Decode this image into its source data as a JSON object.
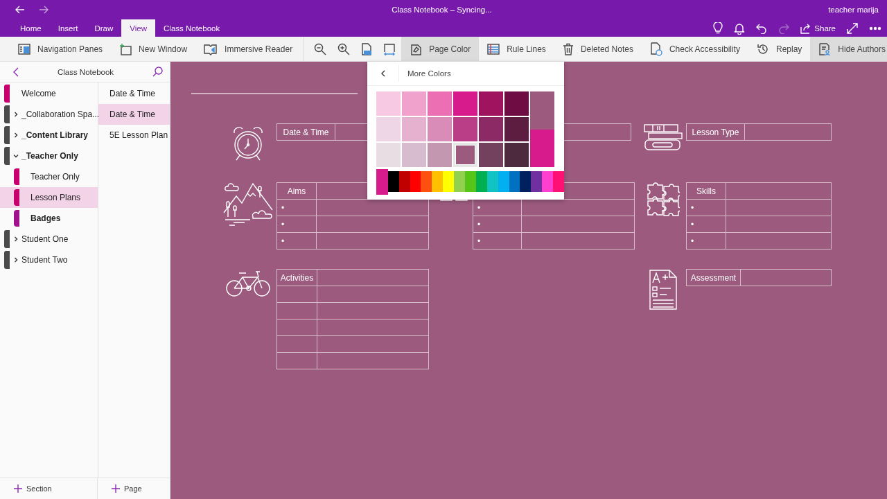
{
  "window": {
    "title": "Class Notebook – Syncing...",
    "user": "teacher marija"
  },
  "tabs": [
    {
      "label": "Home",
      "selected": false
    },
    {
      "label": "Insert",
      "selected": false
    },
    {
      "label": "Draw",
      "selected": false
    },
    {
      "label": "View",
      "selected": true
    },
    {
      "label": "Class Notebook",
      "selected": false
    }
  ],
  "title_actions": [
    {
      "kind": "lightbulb",
      "disabled": false
    },
    {
      "kind": "bell",
      "disabled": false
    },
    {
      "kind": "undo",
      "disabled": false
    },
    {
      "kind": "redo",
      "disabled": true
    },
    {
      "kind": "share",
      "label": "Share",
      "disabled": false
    },
    {
      "kind": "expand",
      "disabled": false
    },
    {
      "kind": "more",
      "disabled": false
    }
  ],
  "ribbon": [
    {
      "kind": "navigation-panes",
      "label": "Navigation Panes",
      "pressed": false
    },
    {
      "kind": "new-window",
      "label": "New Window",
      "pressed": false
    },
    {
      "kind": "immersive-reader",
      "label": "Immersive Reader",
      "pressed": false
    },
    {
      "kind": "zoom-out",
      "pressed": false
    },
    {
      "kind": "zoom-in",
      "pressed": false
    },
    {
      "kind": "zoom-100",
      "pressed": false
    },
    {
      "kind": "page-width",
      "pressed": false
    },
    {
      "kind": "page-color",
      "label": "Page Color",
      "pressed": true
    },
    {
      "kind": "rule-lines",
      "label": "Rule Lines",
      "pressed": false
    },
    {
      "kind": "deleted-notes",
      "label": "Deleted Notes",
      "pressed": false
    },
    {
      "kind": "check-accessibility",
      "label": "Check Accessibility",
      "pressed": false
    },
    {
      "kind": "replay",
      "label": "Replay",
      "pressed": false
    },
    {
      "kind": "hide-authors",
      "label": "Hide Authors",
      "pressed": true
    }
  ],
  "notebook": {
    "title": "Class Notebook",
    "sections": [
      {
        "kind": "section",
        "label": "Welcome",
        "color": "#c8006e",
        "selected": false,
        "unread": false
      },
      {
        "kind": "group",
        "label": "_Collaboration Spa...",
        "color": "#4a4a4a",
        "expanded": false,
        "unread": false
      },
      {
        "kind": "group",
        "label": "_Content Library",
        "color": "#4a4a4a",
        "expanded": false,
        "unread": true
      },
      {
        "kind": "group",
        "label": "_Teacher Only",
        "color": "#4a4a4a",
        "expanded": true,
        "unread": true,
        "children": [
          {
            "label": "Teacher Only",
            "color": "#c8006e",
            "selected": false,
            "unread": false
          },
          {
            "label": "Lesson Plans",
            "color": "#c8006e",
            "selected": true,
            "unread": false
          },
          {
            "label": "Badges",
            "color": "#a0128c",
            "selected": false,
            "unread": true
          }
        ]
      },
      {
        "kind": "group",
        "label": "Student One",
        "color": "#4a4a4a",
        "expanded": false,
        "unread": false
      },
      {
        "kind": "group",
        "label": "Student Two",
        "color": "#4a4a4a",
        "expanded": false,
        "unread": false
      }
    ],
    "pages": [
      {
        "label": "Date & Time",
        "selected": false
      },
      {
        "label": "Date & Time",
        "selected": true
      },
      {
        "label": "5E Lesson Plan",
        "selected": false
      }
    ],
    "add_section": "Section",
    "add_page": "Page"
  },
  "canvas": {
    "blocks": [
      {
        "kind": "alarm-clock",
        "header": "Date & Time"
      },
      {
        "kind": "books",
        "header": "Lesson Type"
      },
      {
        "kind": "mountains",
        "header": "Aims",
        "rows": [
          {
            "kind": "bullet",
            "text": "•"
          },
          {
            "kind": "bullet",
            "text": "•"
          },
          {
            "kind": "bullet",
            "text": "•"
          }
        ]
      },
      {
        "kind": "diagram",
        "rows": [
          {
            "kind": "bullet",
            "text": "•"
          },
          {
            "kind": "bullet",
            "text": "•"
          },
          {
            "kind": "bullet",
            "text": "•"
          }
        ]
      },
      {
        "kind": "puzzle",
        "header": "Skills",
        "rows": [
          {
            "kind": "bullet",
            "text": "•"
          },
          {
            "kind": "bullet",
            "text": "•"
          },
          {
            "kind": "bullet",
            "text": "•"
          }
        ]
      },
      {
        "kind": "bicycle",
        "header": "Activities",
        "rows": [
          {
            "kind": "empty"
          },
          {
            "kind": "empty"
          },
          {
            "kind": "empty"
          },
          {
            "kind": "empty"
          },
          {
            "kind": "empty"
          }
        ]
      },
      {
        "kind": "document",
        "header": "Assessment"
      }
    ]
  },
  "color_popup": {
    "title": "More Colors",
    "swatches": [
      {
        "color": "#f8c9e2",
        "selected": false
      },
      {
        "color": "#f0a1cc",
        "selected": false
      },
      {
        "color": "#ec6fb4",
        "selected": false
      },
      {
        "color": "#d81b8c",
        "selected": false
      },
      {
        "color": "#a0135f",
        "selected": false
      },
      {
        "color": "#6e0c43",
        "selected": false
      },
      {
        "color": "#efd6e6",
        "selected": false
      },
      {
        "color": "#e5b1cf",
        "selected": false
      },
      {
        "color": "#d98cb8",
        "selected": false
      },
      {
        "color": "#b93d87",
        "selected": false
      },
      {
        "color": "#8c2a65",
        "selected": false
      },
      {
        "color": "#5c1d41",
        "selected": false
      },
      {
        "color": "#e8dde3",
        "selected": false
      },
      {
        "color": "#d6bcce",
        "selected": false
      },
      {
        "color": "#c497b0",
        "selected": false
      },
      {
        "color": "#9b5a7e",
        "selected": true
      },
      {
        "color": "#73405e",
        "selected": false
      },
      {
        "color": "#4d2a3e",
        "selected": false
      }
    ],
    "preview": [
      {
        "color": "#9b5a7e"
      },
      {
        "color": "#d81b8c"
      }
    ],
    "custom": {
      "color": "#d81b8c"
    },
    "spectrum": [
      {
        "color": "#000000"
      },
      {
        "color": "#c00000"
      },
      {
        "color": "#ff0000"
      },
      {
        "color": "#ff5010"
      },
      {
        "color": "#ffc000"
      },
      {
        "color": "#ffff00"
      },
      {
        "color": "#92d050"
      },
      {
        "color": "#57c418"
      },
      {
        "color": "#00b050"
      },
      {
        "color": "#12c3c3"
      },
      {
        "color": "#00b0f0"
      },
      {
        "color": "#0070c0"
      },
      {
        "color": "#002060"
      },
      {
        "color": "#7030a0"
      },
      {
        "color": "#ff3fcf"
      },
      {
        "color": "#ff1075"
      }
    ]
  }
}
